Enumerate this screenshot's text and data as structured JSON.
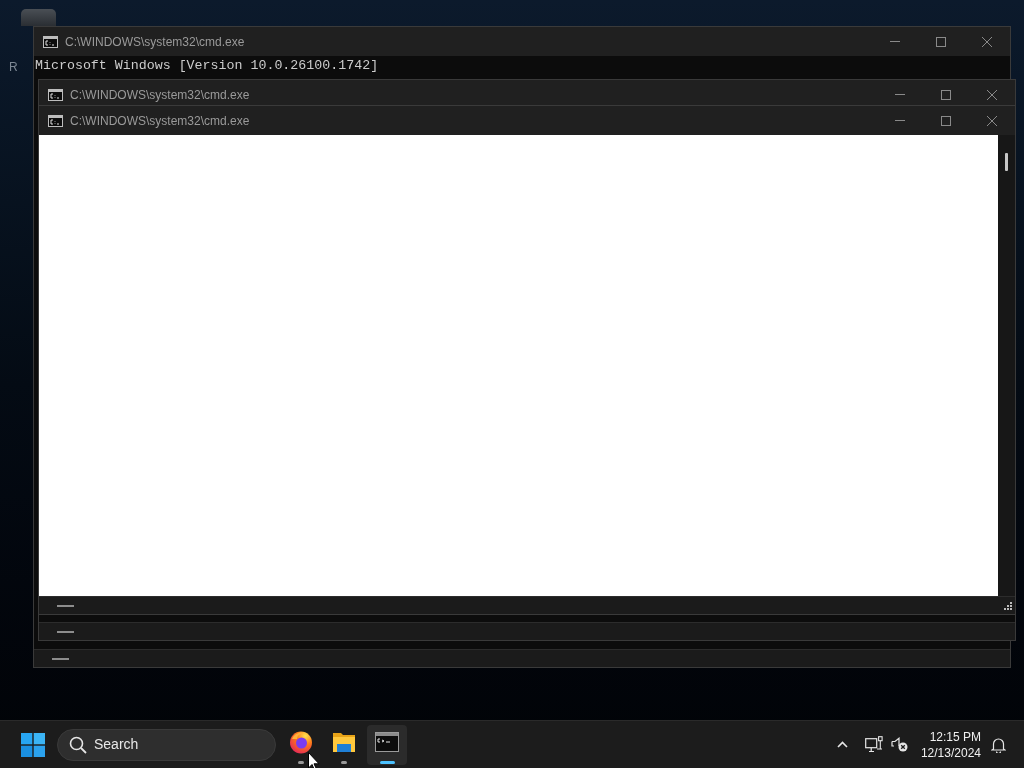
{
  "desktop": {
    "icon_label": "R"
  },
  "windows": [
    {
      "title": "C:\\WINDOWS\\system32\\cmd.exe",
      "kind": "console",
      "lines": [
        "Microsoft Windows [Version 10.0.26100.1742]"
      ]
    },
    {
      "title": "C:\\WINDOWS\\system32\\cmd.exe",
      "kind": "console"
    },
    {
      "title": "C:\\WINDOWS\\system32\\cmd.exe",
      "kind": "blank"
    }
  ],
  "taskbar": {
    "search": {
      "label": "Search"
    },
    "apps": [
      {
        "kind": "firefox",
        "active": false
      },
      {
        "kind": "explorer",
        "active": false
      },
      {
        "kind": "terminal",
        "active": true
      }
    ],
    "clock": {
      "time": "12:15 PM",
      "date": "12/13/2024"
    }
  }
}
